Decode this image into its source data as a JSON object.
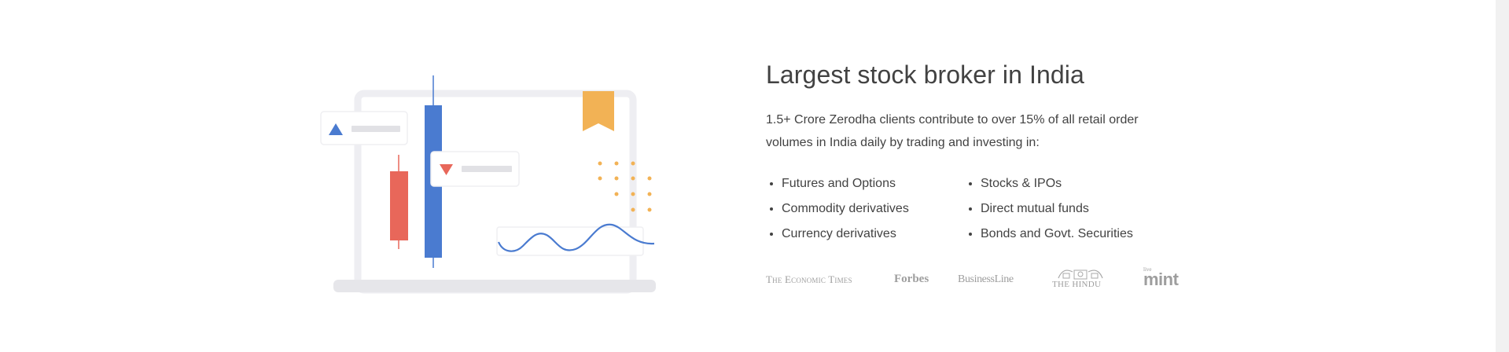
{
  "section": {
    "title": "Largest stock broker in India",
    "description": "1.5+ Crore Zerodha clients contribute to over 15% of all retail order volumes in India daily by trading and investing in:"
  },
  "products": {
    "column_1": [
      "Futures and Options",
      "Commodity derivatives",
      "Currency derivatives"
    ],
    "column_2": [
      "Stocks & IPOs",
      "Direct mutual funds",
      "Bonds and Govt. Securities"
    ]
  },
  "press": {
    "economic_times": "The Economic Times",
    "forbes": "Forbes",
    "business_line": "BusinessLine",
    "the_hindu": "THE HINDU",
    "mint_small": "live",
    "mint": "mint"
  },
  "illustration": {
    "icons": [
      "up-arrow-icon",
      "down-arrow-icon",
      "bookmark-icon"
    ],
    "colors": {
      "blue": "#4a7bd0",
      "red": "#e8675a",
      "orange": "#f2b255",
      "frame": "#eeeef2",
      "placeholder": "#e1e1e5"
    }
  },
  "colors": {
    "text": "#424242",
    "logo": "#9e9e9e"
  }
}
